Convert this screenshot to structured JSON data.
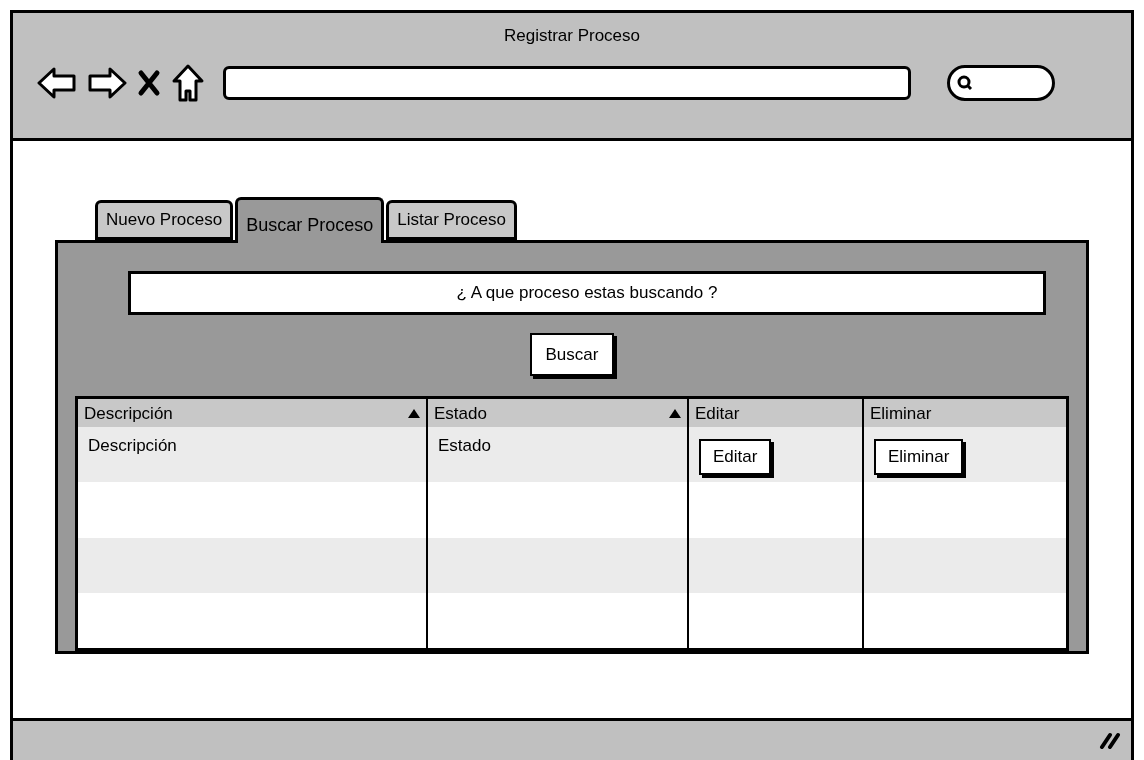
{
  "window": {
    "title": "Registrar Proceso"
  },
  "tabs": [
    {
      "label": "Nuevo Proceso",
      "selected": false
    },
    {
      "label": "Buscar Proceso",
      "selected": true
    },
    {
      "label": "Listar Proceso",
      "selected": false
    }
  ],
  "search": {
    "placeholder": "¿ A que proceso estas buscando ?"
  },
  "search_button": "Buscar",
  "table": {
    "columns": [
      {
        "label": "Descripción",
        "sortable": true
      },
      {
        "label": "Estado",
        "sortable": true
      },
      {
        "label": "Editar",
        "sortable": false
      },
      {
        "label": "Eliminar",
        "sortable": false
      }
    ],
    "rows": [
      {
        "cells": [
          {
            "kind": "text",
            "text": "Descripción"
          },
          {
            "kind": "text",
            "text": "Estado"
          },
          {
            "kind": "button",
            "text": "Editar"
          },
          {
            "kind": "button",
            "text": "Eliminar"
          }
        ]
      }
    ]
  }
}
